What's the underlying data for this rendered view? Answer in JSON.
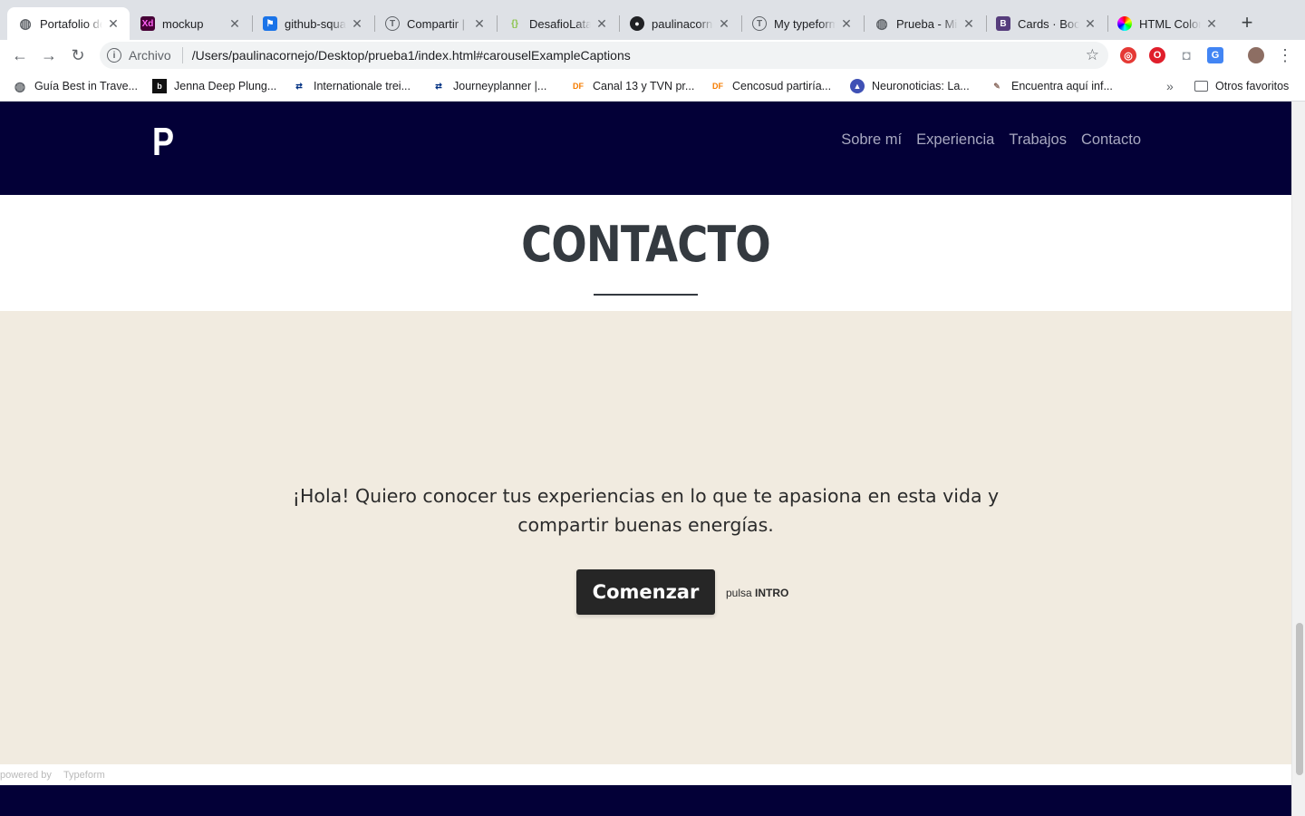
{
  "browser": {
    "tabs": [
      {
        "title": "Portafolio de",
        "icon": "globe-icon",
        "active": true
      },
      {
        "title": "mockup",
        "icon": "xd-icon"
      },
      {
        "title": "github-squa",
        "icon": "flag-icon"
      },
      {
        "title": "Compartir | T",
        "icon": "typeform-icon"
      },
      {
        "title": "DesafioLatam",
        "icon": "desafio-icon"
      },
      {
        "title": "paulinacorne",
        "icon": "github-icon"
      },
      {
        "title": "My typeform",
        "icon": "typeform-icon"
      },
      {
        "title": "Prueba - Mi",
        "icon": "globe-icon"
      },
      {
        "title": "Cards · Boot",
        "icon": "bootstrap-icon"
      },
      {
        "title": "HTML Color",
        "icon": "color-wheel-icon"
      }
    ],
    "address": {
      "scheme_label": "Archivo",
      "url": "/Users/paulinacornejo/Desktop/prueba1/index.html#carouselExampleCaptions"
    },
    "bookmarks": [
      {
        "label": "Guía Best in Trave..."
      },
      {
        "label": "Jenna Deep Plung..."
      },
      {
        "label": "Internationale trei..."
      },
      {
        "label": "Journeyplanner |..."
      },
      {
        "label": "Canal 13 y TVN pr..."
      },
      {
        "label": "Cencosud partiría..."
      },
      {
        "label": "Neuronoticias: La..."
      },
      {
        "label": "Encuentra aquí inf..."
      }
    ],
    "bookmarks_overflow": "»",
    "other_bookmarks": "Otros favoritos"
  },
  "site": {
    "logo": "P",
    "nav": [
      "Sobre mí",
      "Experiencia",
      "Trabajos",
      "Contacto"
    ],
    "section_title": "CONTACTO",
    "form": {
      "prompt_line1": "¡Hola! Quiero conocer tus experiencias en lo que te apasiona en esta vida y",
      "prompt_line2": "compartir buenas energías.",
      "button": "Comenzar",
      "hint_prefix": "pulsa",
      "hint_key": "INTRO"
    },
    "powered_by": "powered by",
    "powered_brand": "Typeform"
  },
  "colors": {
    "nav_bg": "#030037",
    "form_bg": "#f1ebe0",
    "button_bg": "#262626",
    "title": "#343a40"
  }
}
